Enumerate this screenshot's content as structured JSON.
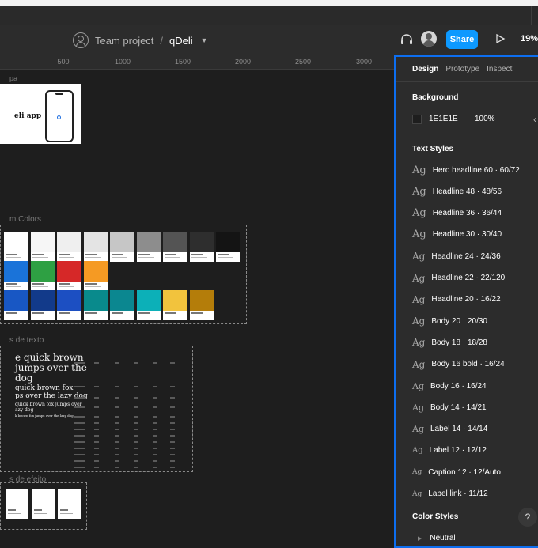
{
  "toolbar": {
    "project": "Team project",
    "separator": "/",
    "file": "qDeli",
    "share_label": "Share",
    "zoom": "19%"
  },
  "ruler": {
    "ticks": [
      "500",
      "1000",
      "1500",
      "2000",
      "2500",
      "3000"
    ]
  },
  "canvas": {
    "artboard_label": "pa",
    "artboard_title": "eli app",
    "colors_label": "m Colors",
    "typography_label": "s de texto",
    "effects_label": "s de efeito",
    "type_samples": [
      "e quick brown",
      " jumps over the",
      "dog",
      "quick brown fox",
      "ps over the lazy dog",
      "quick brown fox jumps over",
      "azy dog",
      "k brown fox jumps over the lazy dog"
    ],
    "colors": {
      "row1": [
        "#ffffff",
        "#f6f6f6",
        "#efefef",
        "#e4e4e4",
        "#c6c6c6",
        "#8d8d8d",
        "#545454",
        "#2e2e2e",
        "#141414"
      ],
      "row2": [
        "#1a73d9",
        "#2ea043",
        "#d62828",
        "#f59a23"
      ],
      "row3": [
        "#1857c4",
        "#123a8a",
        "#1c4fc2",
        "#098a8c",
        "#0b8790",
        "#0cb0b8",
        "#f2c33d",
        "#b47d0a"
      ]
    }
  },
  "panel": {
    "tabs": [
      "Design",
      "Prototype",
      "Inspect"
    ],
    "background_title": "Background",
    "background_hex": "1E1E1E",
    "background_opacity": "100%",
    "text_styles_title": "Text Styles",
    "text_styles": [
      "Hero headline 60 · 60/72",
      "Headline 48 · 48/56",
      "Headline 36 · 36/44",
      "Headline 30 · 30/40",
      "Headline 24 · 24/36",
      "Headline 22 · 22/120",
      "Headline 20 · 16/22",
      "Body 20 · 20/30",
      "Body 18 · 18/28",
      "Body 16 bold · 16/24",
      "Body 16 · 16/24",
      "Body 14 · 14/21",
      "Label 14 · 14/14",
      "Label 12 · 12/12",
      "Caption 12 · 12/Auto",
      "Label link · 11/12"
    ],
    "ag_glyph": "Ag",
    "color_styles_title": "Color Styles",
    "color_group": "Neutral",
    "help": "?"
  }
}
